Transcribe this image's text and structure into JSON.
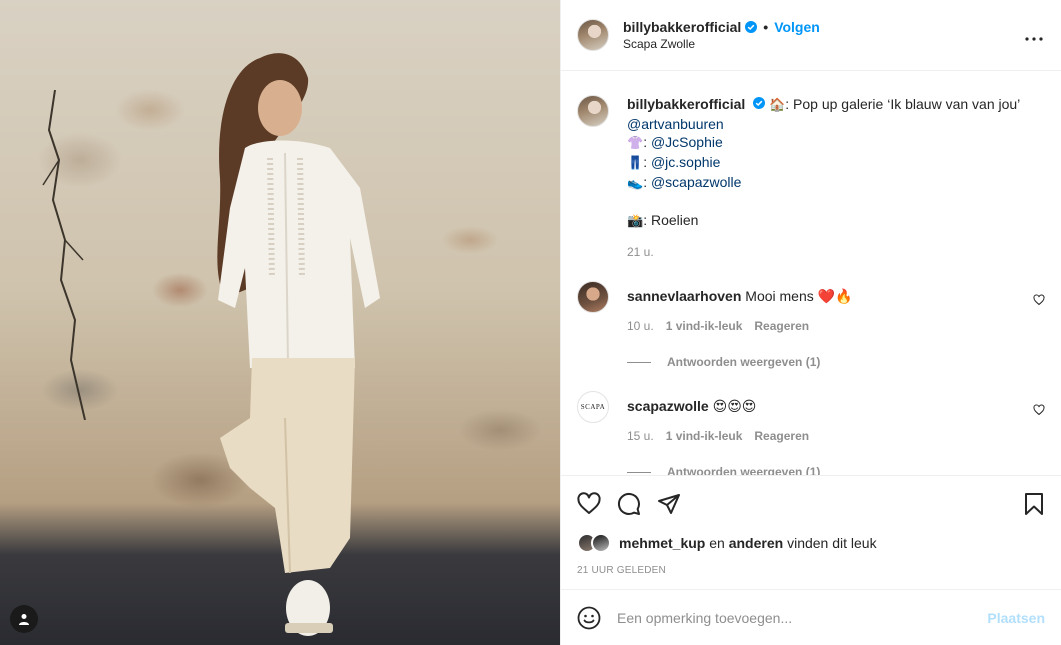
{
  "post": {
    "username": "billybakkerofficial",
    "follow_label": "Volgen",
    "dot": "•",
    "location": "Scapa Zwolle"
  },
  "caption": {
    "username": "billybakkerofficial",
    "line1_emoji": "🏠",
    "line1_text": ": Pop up galerie ‘Ik blauw van van jou’",
    "line2_mention": "@artvanbuuren",
    "line3_emoji": "👚",
    "line3_sep": ": ",
    "line3_mention": "@JcSophie",
    "line4_emoji": "👖",
    "line4_sep": ": ",
    "line4_mention": "@jc.sophie",
    "line5_emoji": "👟",
    "line5_sep": ": ",
    "line5_mention": "@scapazwolle",
    "line6_emoji": "📸",
    "line6_text": ": Roelien",
    "time": "21 u."
  },
  "comments": [
    {
      "username": "sannevlaarhoven",
      "text": "Mooi mens ❤️🔥",
      "time": "10 u.",
      "likes": "1 vind-ik-leuk",
      "reply_label": "Reageren",
      "show_replies": "Antwoorden weergeven (1)"
    },
    {
      "username": "scapazwolle",
      "avatar_text": "SCAPA",
      "text": "😍😍😍",
      "time": "15 u.",
      "likes": "1 vind-ik-leuk",
      "reply_label": "Reageren",
      "show_replies": "Antwoorden weergeven (1)"
    }
  ],
  "likes": {
    "user": "mehmet_kup",
    "and": "en",
    "others": "anderen",
    "suffix": "vinden dit leuk"
  },
  "posted_ago": "21 UUR GELEDEN",
  "add_comment": {
    "placeholder": "Een opmerking toevoegen...",
    "post_label": "Plaatsen"
  },
  "colors": {
    "accent": "#0095f6",
    "mention": "#00376b",
    "muted": "#8e8e8e",
    "post_disabled": "#b2dffc"
  },
  "icons": [
    "verified-badge-icon",
    "more-options-icon",
    "heart-icon",
    "comment-icon",
    "share-icon",
    "bookmark-icon",
    "emoji-icon",
    "user-tag-icon"
  ]
}
